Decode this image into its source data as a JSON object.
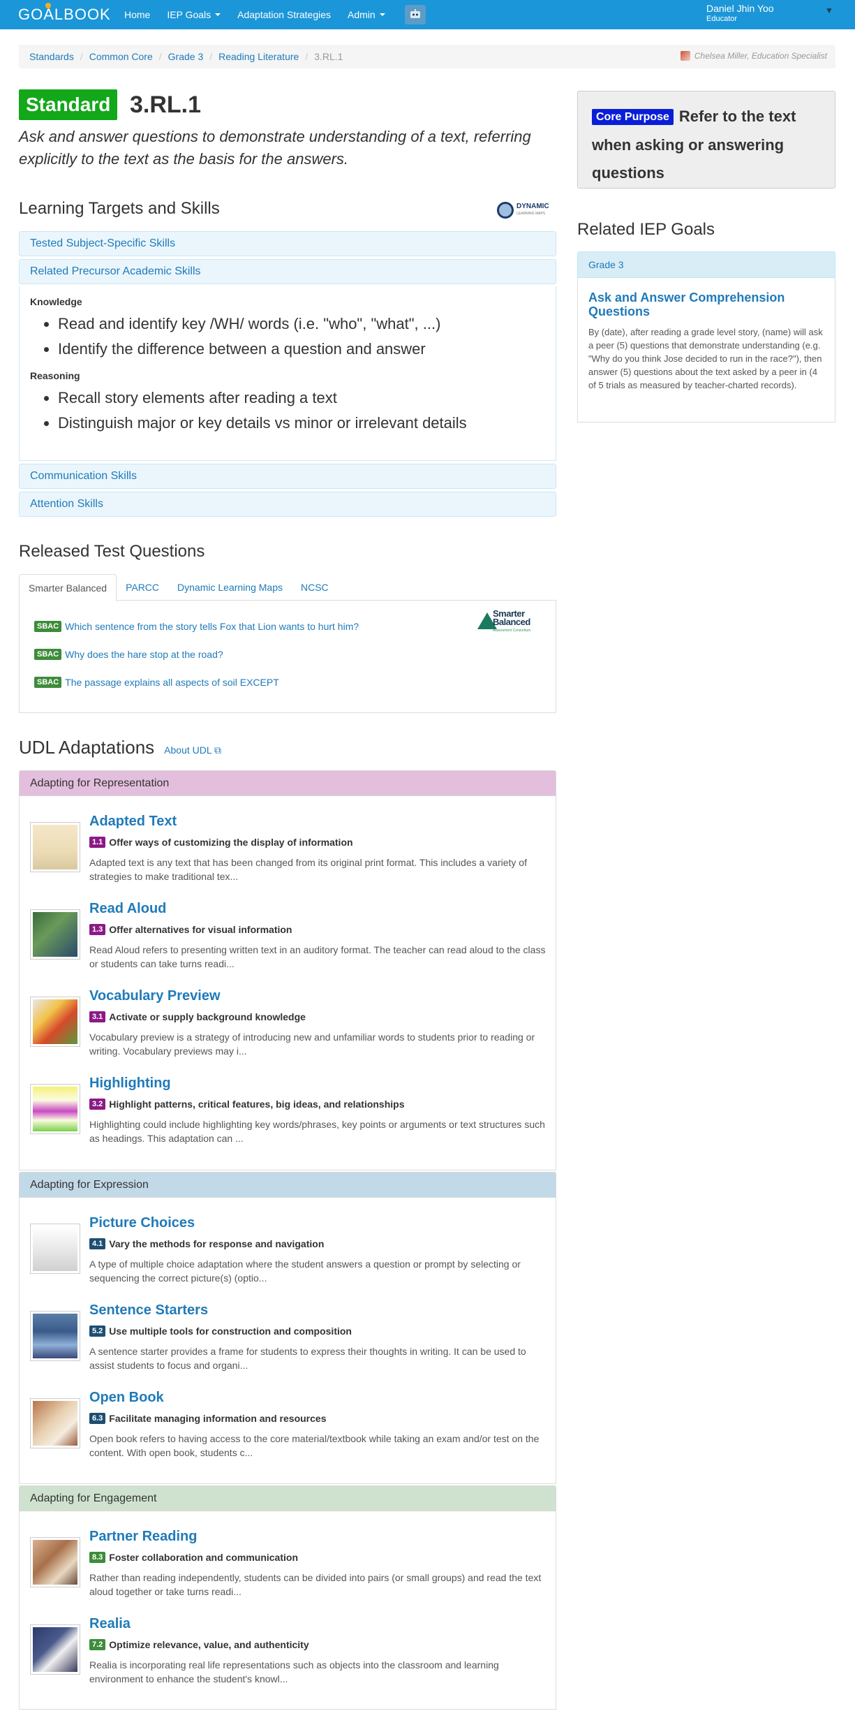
{
  "navbar": {
    "logo_text": "GOALBOOK",
    "items": [
      {
        "label": "Home",
        "dropdown": false
      },
      {
        "label": "IEP Goals",
        "dropdown": true
      },
      {
        "label": "Adaptation Strategies",
        "dropdown": false
      },
      {
        "label": "Admin",
        "dropdown": true
      }
    ],
    "admin_icon": "robot-icon",
    "user_name": "Daniel Jhin Yoo",
    "user_role": "Educator"
  },
  "breadcrumb": {
    "items": [
      "Standards",
      "Common Core",
      "Grade 3",
      "Reading Literature"
    ],
    "current": "3.RL.1",
    "author": "Chelsea Miller, Education Specialist"
  },
  "standard": {
    "badge": "Standard",
    "code": "3.RL.1",
    "description": "Ask and answer questions to demonstrate understanding of a text, referring explicitly to the text as the basis for the answers."
  },
  "learning_targets": {
    "title": "Learning Targets and Skills",
    "logo_text": "DYNAMIC",
    "logo_sub": "LEARNING MAPS",
    "panels": [
      "Tested Subject-Specific Skills",
      "Related Precursor Academic Skills",
      "Communication Skills",
      "Attention Skills"
    ],
    "knowledge_label": "Knowledge",
    "knowledge": [
      "Read and identify key /WH/ words (i.e. \"who\", \"what\", ...)",
      "Identify the difference between a question and answer"
    ],
    "reasoning_label": "Reasoning",
    "reasoning": [
      "Recall story elements after reading a text",
      "Distinguish major or key details vs minor or irrelevant details"
    ]
  },
  "released_tests": {
    "title": "Released Test Questions",
    "tabs": [
      "Smarter Balanced",
      "PARCC",
      "Dynamic Learning Maps",
      "NCSC"
    ],
    "active_tab": "Smarter Balanced",
    "logo_text": "Smarter Balanced",
    "logo_sub": "Assessment Consortium",
    "questions": [
      {
        "badge": "SBAC",
        "text": "Which sentence from the story tells Fox that Lion wants to hurt him?"
      },
      {
        "badge": "SBAC",
        "text": "Why does the hare stop at the road?"
      },
      {
        "badge": "SBAC",
        "text": "The passage explains all aspects of soil EXCEPT"
      }
    ]
  },
  "udl": {
    "title": "UDL Adaptations",
    "about_link": "About UDL",
    "groups": [
      {
        "title": "Adapting for Representation",
        "head_color": "#e3bfdd",
        "badge_color": "#8b1a86",
        "items": [
          {
            "name": "Adapted Text",
            "code": "1.1",
            "principle": "Offer ways of customizing the display of information",
            "desc": "Adapted text is any text that has been changed from its original print format. This includes a variety of strategies to make traditional tex..."
          },
          {
            "name": "Read Aloud",
            "code": "1.3",
            "principle": "Offer alternatives for visual information",
            "desc": "Read Aloud refers to presenting written text in an auditory format. The teacher can read aloud to the class or students can take turns readi..."
          },
          {
            "name": "Vocabulary Preview",
            "code": "3.1",
            "principle": "Activate or supply background knowledge",
            "desc": "Vocabulary preview is a strategy of introducing new and unfamiliar words to students prior to reading or writing. Vocabulary previews may i..."
          },
          {
            "name": "Highlighting",
            "code": "3.2",
            "principle": "Highlight patterns, critical features, big ideas, and relationships",
            "desc": "Highlighting could include highlighting key words/phrases, key points or arguments or text structures such as headings. This adaptation can ..."
          }
        ]
      },
      {
        "title": "Adapting for Expression",
        "head_color": "#c2d9e8",
        "badge_color": "#1d4f72",
        "items": [
          {
            "name": "Picture Choices",
            "code": "4.1",
            "principle": "Vary the methods for response and navigation",
            "desc": "A type of multiple choice adaptation where the student answers a question or prompt by selecting or sequencing the correct picture(s) (optio..."
          },
          {
            "name": "Sentence Starters",
            "code": "5.2",
            "principle": "Use multiple tools for construction and composition",
            "desc": "A sentence starter provides a frame for students to express their thoughts in writing. It can be used to assist students to focus and organi..."
          },
          {
            "name": "Open Book",
            "code": "6.3",
            "principle": "Facilitate managing information and resources",
            "desc": "Open book refers to having access to the core material/textbook while taking an exam and/or test on the content. With open book, students c..."
          }
        ]
      },
      {
        "title": "Adapting for Engagement",
        "head_color": "#cfe2cf",
        "badge_color": "#3d8c3a",
        "items": [
          {
            "name": "Partner Reading",
            "code": "8.3",
            "principle": "Foster collaboration and communication",
            "desc": "Rather than reading independently, students can be divided into pairs (or small groups) and read the text aloud together or take turns readi..."
          },
          {
            "name": "Realia",
            "code": "7.2",
            "principle": "Optimize relevance, value, and authenticity",
            "desc": "Realia is incorporating real life representations such as objects into the classroom and learning environment to enhance the student's knowl..."
          }
        ]
      }
    ]
  },
  "core_purpose": {
    "badge": "Core Purpose",
    "text": "Refer to the text when asking or answering questions"
  },
  "iep": {
    "title": "Related IEP Goals",
    "grade": "Grade 3",
    "goal_title": "Ask and Answer Comprehension Questions",
    "goal_text": "By (date), after reading a grade level story, (name) will ask a peer (5) questions that demonstrate understanding (e.g. \"Why do you think Jose decided to run in the race?\"), then answer (5) questions about the text asked by a peer in (4 of 5 trials as measured by teacher-charted records)."
  },
  "colors": {
    "navbar": "#1b96d8",
    "standard_badge": "#13a81a",
    "core_purpose_badge": "#0a1ed8",
    "link": "#1f7ab9",
    "sbac_badge": "#3d8c3a"
  }
}
